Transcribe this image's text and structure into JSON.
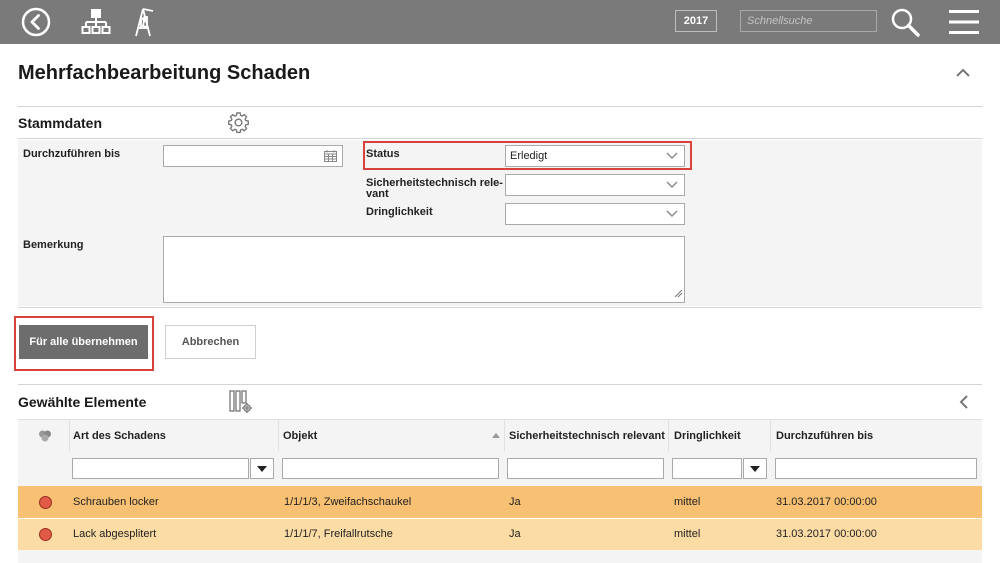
{
  "topbar": {
    "year": "2017",
    "search_placeholder": "Schnellsuche",
    "icons": [
      "back-circle-icon",
      "hierarchy-icon",
      "playground-swing-icon",
      "search-icon",
      "hamburger-menu-icon"
    ]
  },
  "page": {
    "title": "Mehrfachbearbeitung Schaden"
  },
  "stammdaten": {
    "title": "Stammdaten",
    "durchzufuehren_label": "Durchzuführen bis",
    "durchzufuehren_value": "",
    "status_label": "Status",
    "status_value": "Erledigt",
    "sicherheit_label_1": "Sicherheitstechnisch rele-",
    "sicherheit_label_2": "vant",
    "sicherheit_value": "",
    "dringlichkeit_label": "Dringlichkeit",
    "dringlichkeit_value": "",
    "bemerkung_label": "Bemerkung",
    "bemerkung_value": ""
  },
  "actions": {
    "apply_all": "Für alle übernehmen",
    "cancel": "Abbrechen"
  },
  "selected": {
    "title": "Gewählte Elemente",
    "columns": [
      "Art des Schadens",
      "Objekt",
      "Sicherheitstechnisch relevant",
      "Dringlichkeit",
      "Durchzuführen bis"
    ],
    "rows": [
      {
        "art": "Schrauben locker",
        "objekt": "1/1/1/3, Zweifachschaukel",
        "sicherheit": "Ja",
        "dringlichkeit": "mittel",
        "datum": "31.03.2017 00:00:00",
        "row_color": "#f8c072"
      },
      {
        "art": "Lack abgesplitert",
        "objekt": "1/1/1/7, Freifallrutsche",
        "sicherheit": "Ja",
        "dringlichkeit": "mittel",
        "datum": "31.03.2017 00:00:00",
        "row_color": "#fcdca5"
      }
    ]
  },
  "colors": {
    "topbar": "#7a7a7a",
    "highlight_border": "#d9413c",
    "status_dot": "#e05a46"
  }
}
